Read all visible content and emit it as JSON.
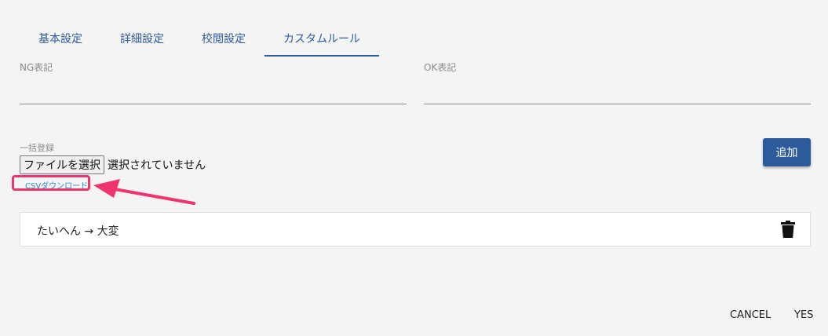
{
  "tabs": [
    {
      "label": "基本設定",
      "active": false
    },
    {
      "label": "詳細設定",
      "active": false
    },
    {
      "label": "校閲設定",
      "active": false
    },
    {
      "label": "カスタムルール",
      "active": true
    }
  ],
  "fields": {
    "ng_label": "NG表記",
    "ng_value": "",
    "ok_label": "OK表記",
    "ok_value": ""
  },
  "bulk": {
    "label": "一括登録",
    "file_button": "ファイルを選択",
    "file_status": "選択されていません",
    "csv_download": "CSVダウンロード"
  },
  "add_button": "追加",
  "rules": [
    {
      "text": "たいへん → 大変"
    }
  ],
  "footer": {
    "cancel": "CANCEL",
    "yes": "YES"
  },
  "colors": {
    "accent": "#2d5a9b",
    "highlight": "#f0356e",
    "link": "#2a8ccc"
  }
}
